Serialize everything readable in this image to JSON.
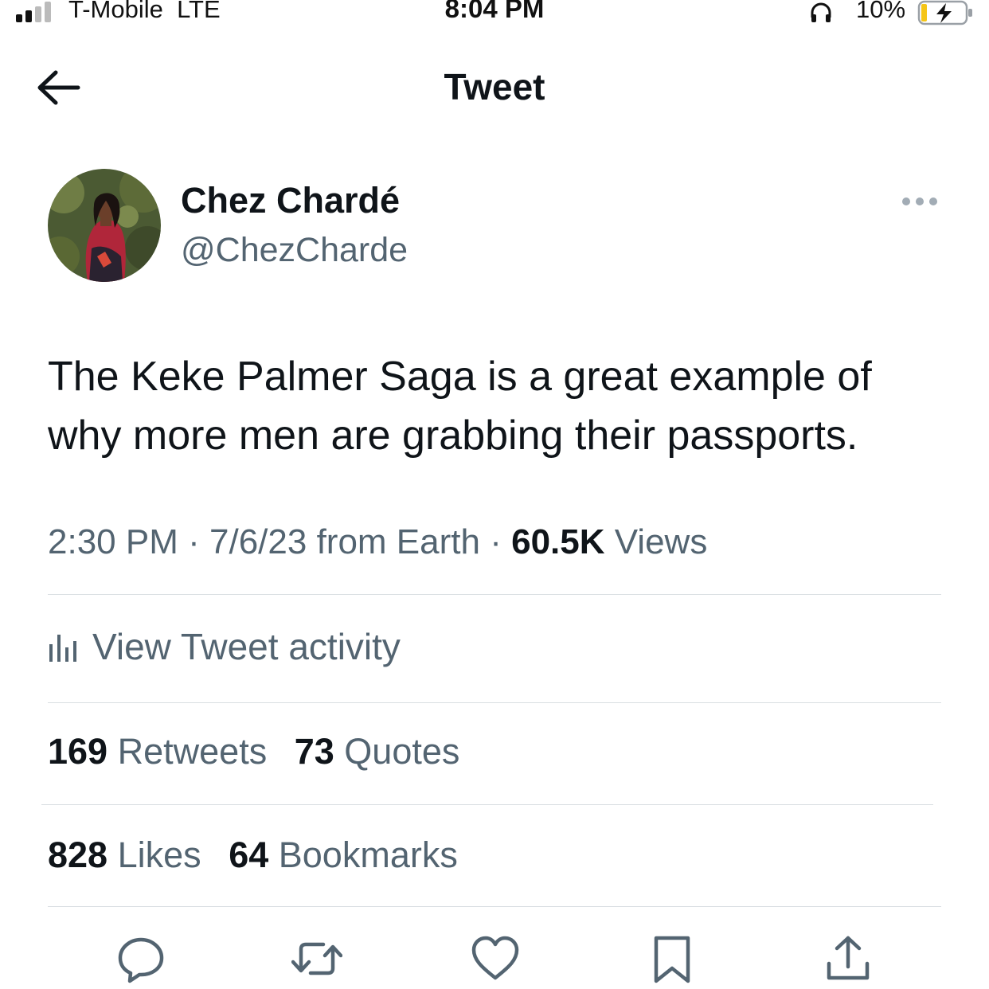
{
  "status_bar": {
    "carrier": "T-Mobile",
    "network": "LTE",
    "time": "8:04 PM",
    "battery_percent": "10%",
    "battery_level": 0.1,
    "icons": [
      "signal-icon",
      "headphone-icon",
      "battery-charging-icon"
    ]
  },
  "nav": {
    "title": "Tweet",
    "back_icon": "arrow-left-icon"
  },
  "author": {
    "display_name": "Chez Chardé",
    "handle": "@ChezCharde",
    "more_icon": "ellipsis-icon"
  },
  "tweet": {
    "text": "The Keke Palmer Saga is a great example of why more men are grabbing their passports.",
    "time": "2:30 PM",
    "date": "7/6/23",
    "source": "from Earth",
    "separator": "·",
    "views_count": "60.5K",
    "views_label": "Views"
  },
  "activity": {
    "label": "View Tweet activity",
    "icon": "bar-chart-icon"
  },
  "stats": {
    "retweets_count": "169",
    "retweets_label": "Retweets",
    "quotes_count": "73",
    "quotes_label": "Quotes",
    "likes_count": "828",
    "likes_label": "Likes",
    "bookmarks_count": "64",
    "bookmarks_label": "Bookmarks"
  },
  "actions": [
    "reply-icon",
    "retweet-icon",
    "like-icon",
    "bookmark-icon",
    "share-icon"
  ],
  "colors": {
    "text_primary": "#0f1419",
    "text_secondary": "#536471",
    "divider": "#d9dee2",
    "battery_charging": "#f5c518"
  }
}
